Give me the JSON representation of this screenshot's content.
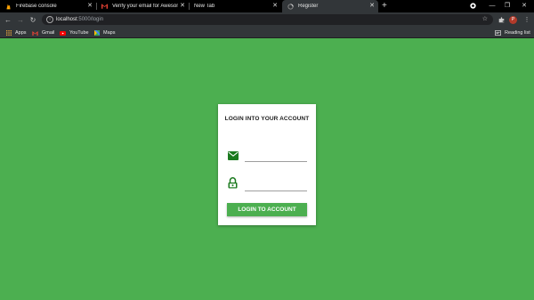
{
  "browser": {
    "tabs": [
      {
        "title": "Firebase console",
        "icon": "firebase-icon"
      },
      {
        "title": "Verify your email for Awesome A",
        "icon": "gmail-icon"
      },
      {
        "title": "New Tab",
        "icon": ""
      },
      {
        "title": "Register",
        "icon": "loading-icon",
        "active": true
      }
    ],
    "new_tab_label": "+",
    "url_host": "localhost",
    "url_path": ":5000/login",
    "profile_initial": "P",
    "bookmarks": [
      {
        "label": "Apps",
        "icon": "apps-grid-icon"
      },
      {
        "label": "Gmail",
        "icon": "gmail-icon"
      },
      {
        "label": "YouTube",
        "icon": "youtube-icon"
      },
      {
        "label": "Maps",
        "icon": "maps-icon"
      }
    ],
    "reading_list_label": "Reading list"
  },
  "login": {
    "title": "LOGIN INTO YOUR ACCOUNT",
    "email_value": "",
    "password_value": "",
    "button_label": "LOGIN TO ACCOUNT"
  },
  "colors": {
    "background": "#4caf50",
    "icon_green": "#1b7a1f",
    "button": "#4caf50"
  }
}
